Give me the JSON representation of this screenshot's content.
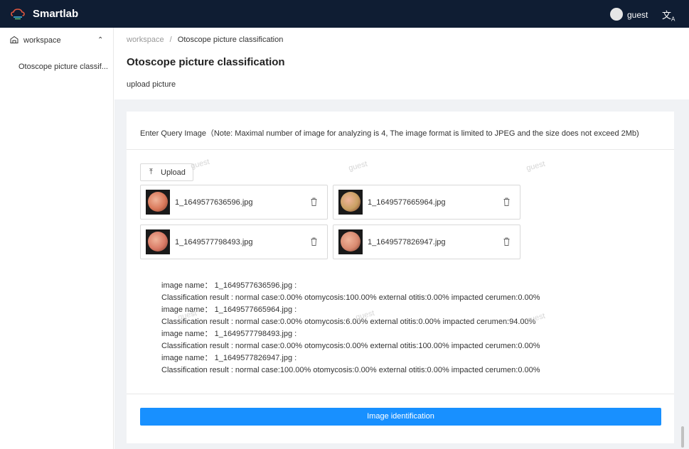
{
  "app": {
    "name": "Smartlab"
  },
  "topbar": {
    "username": "guest",
    "lang_icon": "translate-icon"
  },
  "sidebar": {
    "group_label": "workspace",
    "group_icon": "workspace-icon",
    "items": [
      {
        "label": "Otoscope picture classif..."
      }
    ]
  },
  "breadcrumb": {
    "root": "workspace",
    "separator": "/",
    "current": "Otoscope picture classification"
  },
  "page": {
    "title": "Otoscope picture classification",
    "subtitle": "upload picture"
  },
  "card": {
    "instruction": "Enter Query Image（Note: Maximal number of image for analyzing is 4, The image format is limited to JPEG and the size does not exceed 2Mb)",
    "upload_label": "Upload",
    "files": [
      {
        "name": "1_1649577636596.jpg",
        "tint": "#d9785a"
      },
      {
        "name": "1_1649577665964.jpg",
        "tint": "#c9a063"
      },
      {
        "name": "1_1649577798493.jpg",
        "tint": "#d97a66"
      },
      {
        "name": "1_1649577826947.jpg",
        "tint": "#d88a70"
      }
    ],
    "results": [
      "image name： 1_1649577636596.jpg :",
      "Classification result : normal case:0.00% otomycosis:100.00% external otitis:0.00% impacted cerumen:0.00%",
      "image name： 1_1649577665964.jpg :",
      "Classification result : normal case:0.00% otomycosis:6.00% external otitis:0.00% impacted cerumen:94.00%",
      "image name： 1_1649577798493.jpg :",
      "Classification result : normal case:0.00% otomycosis:0.00% external otitis:100.00% impacted cerumen:0.00%",
      "image name： 1_1649577826947.jpg :",
      "Classification result : normal case:100.00% otomycosis:0.00% external otitis:0.00% impacted cerumen:0.00%"
    ],
    "action_label": "Image identification"
  },
  "watermark": {
    "text": "guest"
  },
  "colors": {
    "topbar": "#0f1d33",
    "primary": "#1890ff",
    "content_bg": "#f0f2f5"
  }
}
